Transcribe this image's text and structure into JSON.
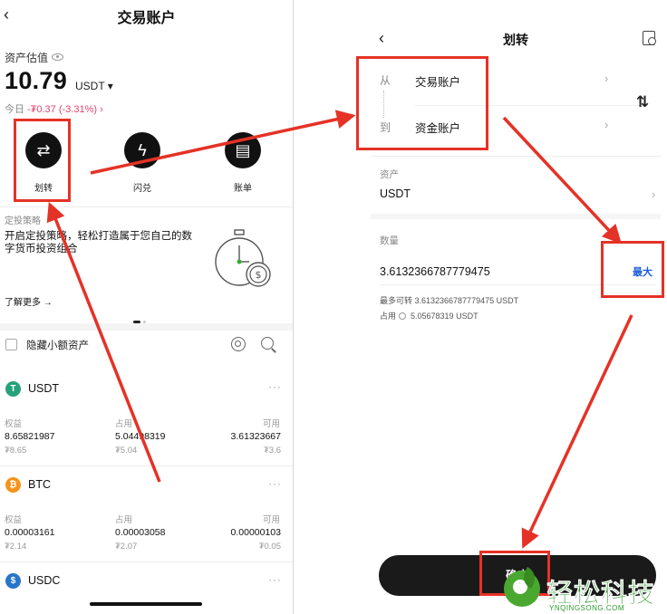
{
  "left": {
    "title": "交易账户",
    "back_glyph": "‹",
    "estimate_label": "资产估值",
    "total_amount": "10.79",
    "total_unit": "USDT ▾",
    "today_label": "今日",
    "today_change": "-₮0.37 (-3.31%) ›",
    "actions": [
      {
        "label": "划转",
        "icon": "transfer-icon",
        "glyph": "⇄"
      },
      {
        "label": "闪兑",
        "icon": "flash-swap-icon",
        "glyph": "ϟ"
      },
      {
        "label": "账单",
        "icon": "bill-icon",
        "glyph": "▤"
      }
    ],
    "strategy": {
      "section_title": "定投策略",
      "body": "开启定投策略，轻松打造属于您自己的数字货币投资组合",
      "learn_more": "了解更多 →"
    },
    "hide_small_assets": "隐藏小额资产",
    "columns": {
      "equity": "权益",
      "occupied": "占用",
      "available": "可用"
    },
    "assets": [
      {
        "name": "USDT",
        "icon_letter": "T",
        "color": "#26a17b",
        "equity": "8.65821987",
        "equity_fiat": "₮8.65",
        "occupied": "5.04498319",
        "occupied_fiat": "₮5.04",
        "available": "3.61323667",
        "available_fiat": "₮3.6"
      },
      {
        "name": "BTC",
        "icon_letter": "₿",
        "color": "#f7931a",
        "equity": "0.00003161",
        "equity_fiat": "₮2.14",
        "occupied": "0.00003058",
        "occupied_fiat": "₮2.07",
        "available": "0.00000103",
        "available_fiat": "₮0.05"
      },
      {
        "name": "USDC",
        "icon_letter": "$",
        "color": "#2775ca"
      }
    ],
    "more_glyph": "···"
  },
  "right": {
    "title": "划转",
    "back_glyph": "‹",
    "from_label": "从",
    "from_account": "交易账户",
    "to_label": "到",
    "to_account": "资金账户",
    "swap_glyph": "⇅",
    "asset_label": "资产",
    "asset_value": "USDT",
    "amount_label": "数量",
    "amount_value": "3.6132366787779475",
    "max_label": "最大",
    "max_transferable": "最多可转 3.6132366787779475 USDT",
    "occupied_label": "占用",
    "occupied_value": "5.05678319 USDT",
    "confirm_label": "确定",
    "chevron": "›"
  },
  "watermark": {
    "text": "轻松科技",
    "sub": "YNQINGSONG.COM"
  },
  "colors": {
    "annotation_red": "#e53226",
    "negative": "#e0446b",
    "link_blue": "#1e5fd8",
    "watermark_green": "#2d9a2d"
  }
}
